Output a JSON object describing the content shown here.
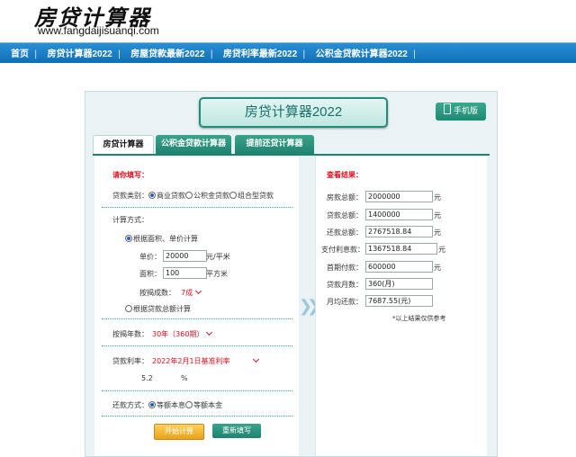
{
  "site": {
    "logo": "房贷计算器",
    "url": "www.fangdaijisuanqi.com"
  },
  "nav": {
    "items": [
      "首页",
      "房贷计算器2022",
      "房屋贷款最新2022",
      "房贷利率最新2022",
      "公积金贷款计算器2022"
    ],
    "separator": "|"
  },
  "header": {
    "title": "房贷计算器2022",
    "mobile_label": "手机版"
  },
  "tabs": [
    "房贷计算器2022",
    "公积金贷款计算器",
    "提前还贷计算器"
  ],
  "form": {
    "section_title": "请你填写：",
    "loan_type_label": "贷款类别：",
    "loan_types": [
      "商业贷款",
      "公积金贷款",
      "组合型贷款"
    ],
    "calc_method_label": "计算方式：",
    "by_area_label": "根据面积、单价计算",
    "unit_price_label": "单价：",
    "unit_price_value": "20000",
    "unit_price_unit": "元/平米",
    "area_label": "面积：",
    "area_value": "100",
    "area_unit": "平方米",
    "ratio_label": "按揭成数：",
    "ratio_value": "7成",
    "by_total_label": "根据贷款总额计算",
    "years_label": "按揭年数：",
    "years_value": "30年（360期）",
    "rate_label": "贷款利率：",
    "rate_value": "2022年2月1日基准利率",
    "rate_number": "5.2",
    "rate_unit": "%",
    "repay_label": "还款方式：",
    "repay_options": [
      "等额本息",
      "等额本金"
    ],
    "calc_button": "开始计算",
    "reset_button": "重新填写"
  },
  "results": {
    "title": "查看结果：",
    "rows": [
      {
        "label": "房款总额：",
        "value": "2000000",
        "unit": "元"
      },
      {
        "label": "贷款总额：",
        "value": "1400000",
        "unit": "元"
      },
      {
        "label": "还款总额：",
        "value": "2767518.84",
        "unit": "元"
      },
      {
        "label": "支付利息款：",
        "value": "1367518.84",
        "unit": "元"
      },
      {
        "label": "首期付款：",
        "value": "600000",
        "unit": "元"
      },
      {
        "label": "贷款月数：",
        "value": "360(月)",
        "unit": ""
      },
      {
        "label": "月均还款：",
        "value": "7687.55(元)",
        "unit": ""
      }
    ],
    "note": "*以上结果仅供参考"
  }
}
